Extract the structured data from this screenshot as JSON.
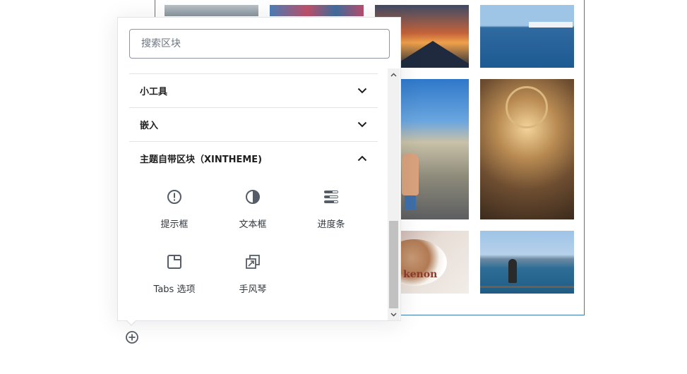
{
  "search": {
    "placeholder": "搜索区块"
  },
  "panels": [
    {
      "title": "小工具",
      "expanded": false
    },
    {
      "title": "嵌入",
      "expanded": false
    },
    {
      "title": "主题自带区块（XINTHEME)",
      "expanded": true
    }
  ],
  "blocks": [
    {
      "label": "提示框",
      "icon": "alert-circle-icon"
    },
    {
      "label": "文本框",
      "icon": "half-circle-icon"
    },
    {
      "label": "进度条",
      "icon": "progress-bars-icon"
    },
    {
      "label": "Tabs 选项",
      "icon": "tabs-icon"
    },
    {
      "label": "手风琴",
      "icon": "accordion-icon"
    }
  ],
  "gallery": {
    "coffee_brand": "kenon"
  },
  "colors": {
    "text": "#1e1e1e",
    "icon": "#555d66",
    "border": "#e2e4e7",
    "input_border": "#8d96a0",
    "gallery_border": "#3a7bb5"
  }
}
